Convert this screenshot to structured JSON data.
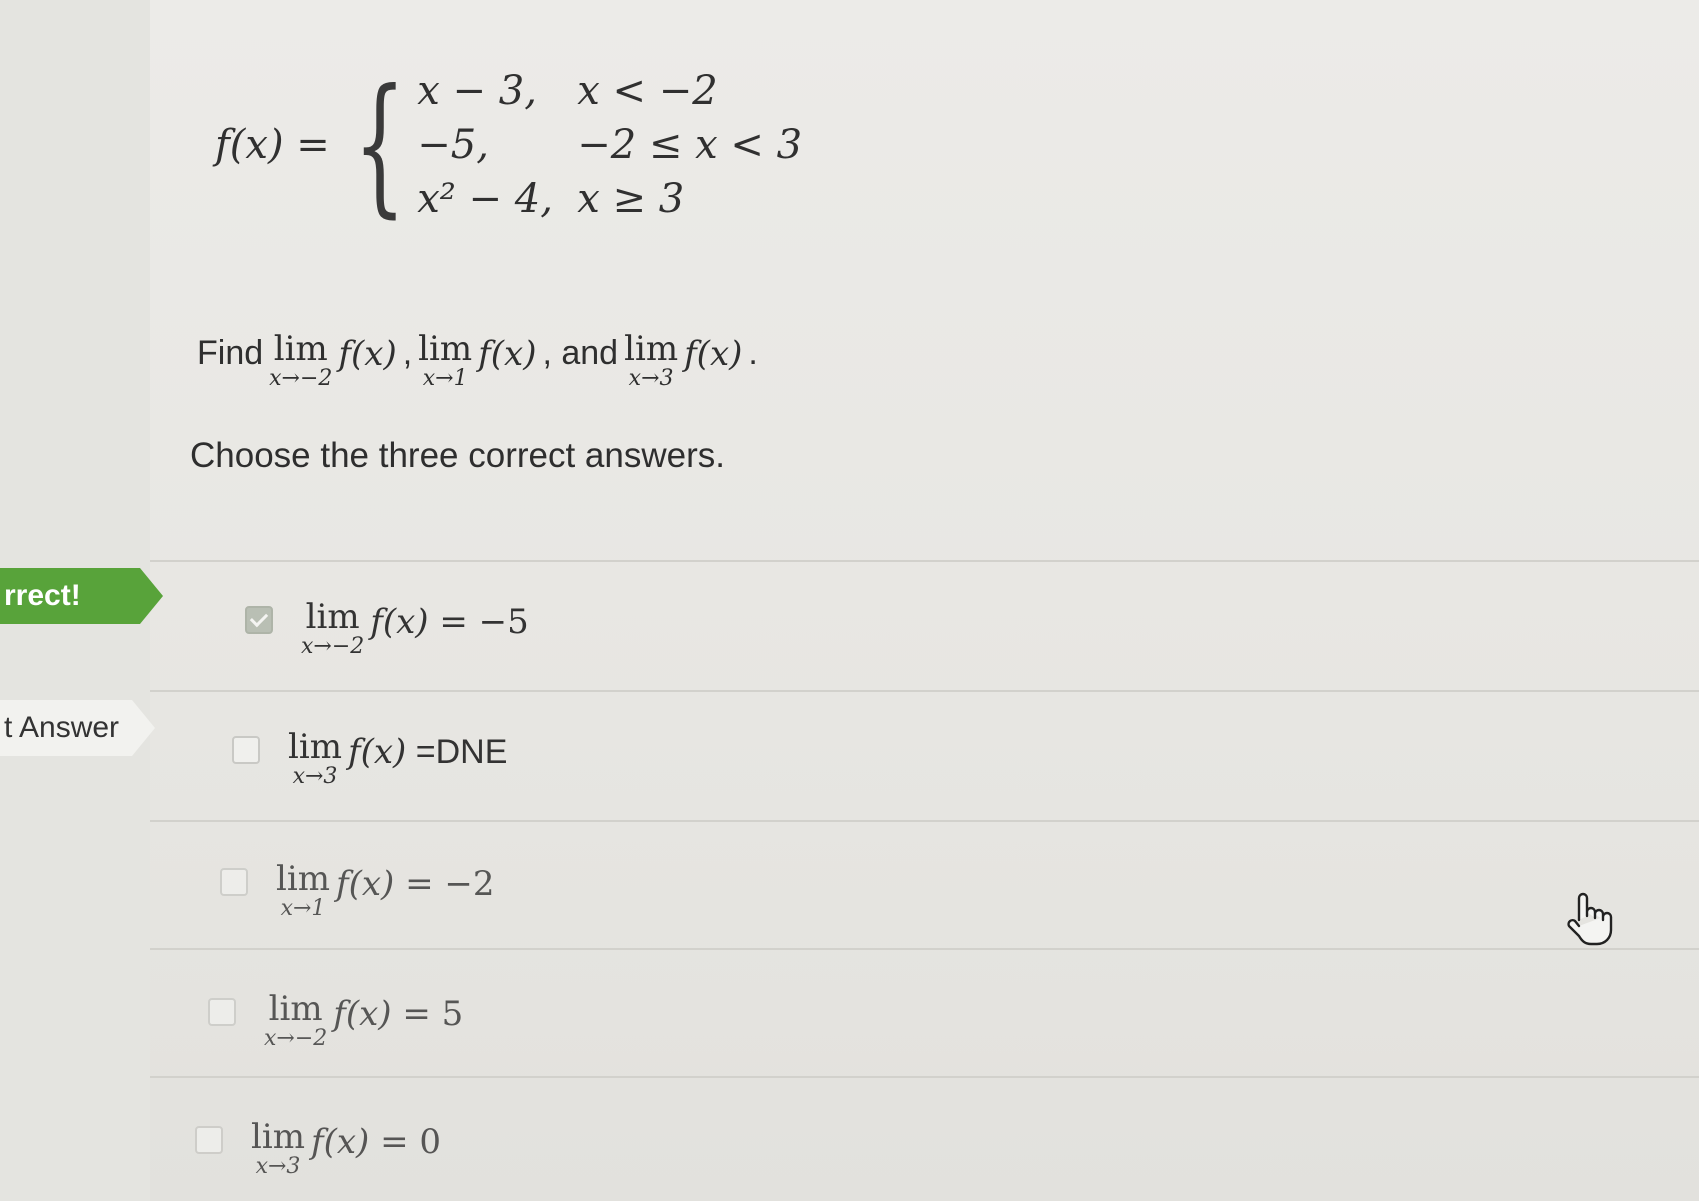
{
  "function_definition": {
    "lhs": "f(x) =",
    "cases": [
      {
        "expr": "x − 3,",
        "condition": "x < −2"
      },
      {
        "expr": "−5,",
        "condition": "−2 ≤ x < 3"
      },
      {
        "expr": "x² − 4,",
        "condition": "x ≥ 3"
      }
    ]
  },
  "question": {
    "find": "Find",
    "lim_word": "lim",
    "lim1_sub": "x→−2",
    "lim2_sub": "x→1",
    "lim3_sub": "x→3",
    "fx": "f(x)",
    "sep1": ",",
    "sep2": ", and",
    "end": "."
  },
  "instruction": "Choose the three correct answers.",
  "tags": {
    "correct": "rrect!",
    "answer": "t Answer"
  },
  "options": [
    {
      "lim_sub": "x→−2",
      "rhs_fx": "f(x)",
      "rhs_tail": " = −5",
      "checked": true
    },
    {
      "lim_sub": "x→3",
      "rhs_fx": "f(x)",
      "rhs_tail": " =DNE",
      "checked": false
    },
    {
      "lim_sub": "x→1",
      "rhs_fx": "f(x)",
      "rhs_tail": " = −2",
      "checked": false
    },
    {
      "lim_sub": "x→−2",
      "rhs_fx": "f(x)",
      "rhs_tail": " = 5",
      "checked": false
    },
    {
      "lim_sub": "x→3",
      "rhs_fx": "f(x)",
      "rhs_tail": " = 0",
      "checked": false
    }
  ],
  "icons": {
    "checkbox_checked": "checkmark-icon",
    "cursor": "hand-pointer-icon"
  }
}
